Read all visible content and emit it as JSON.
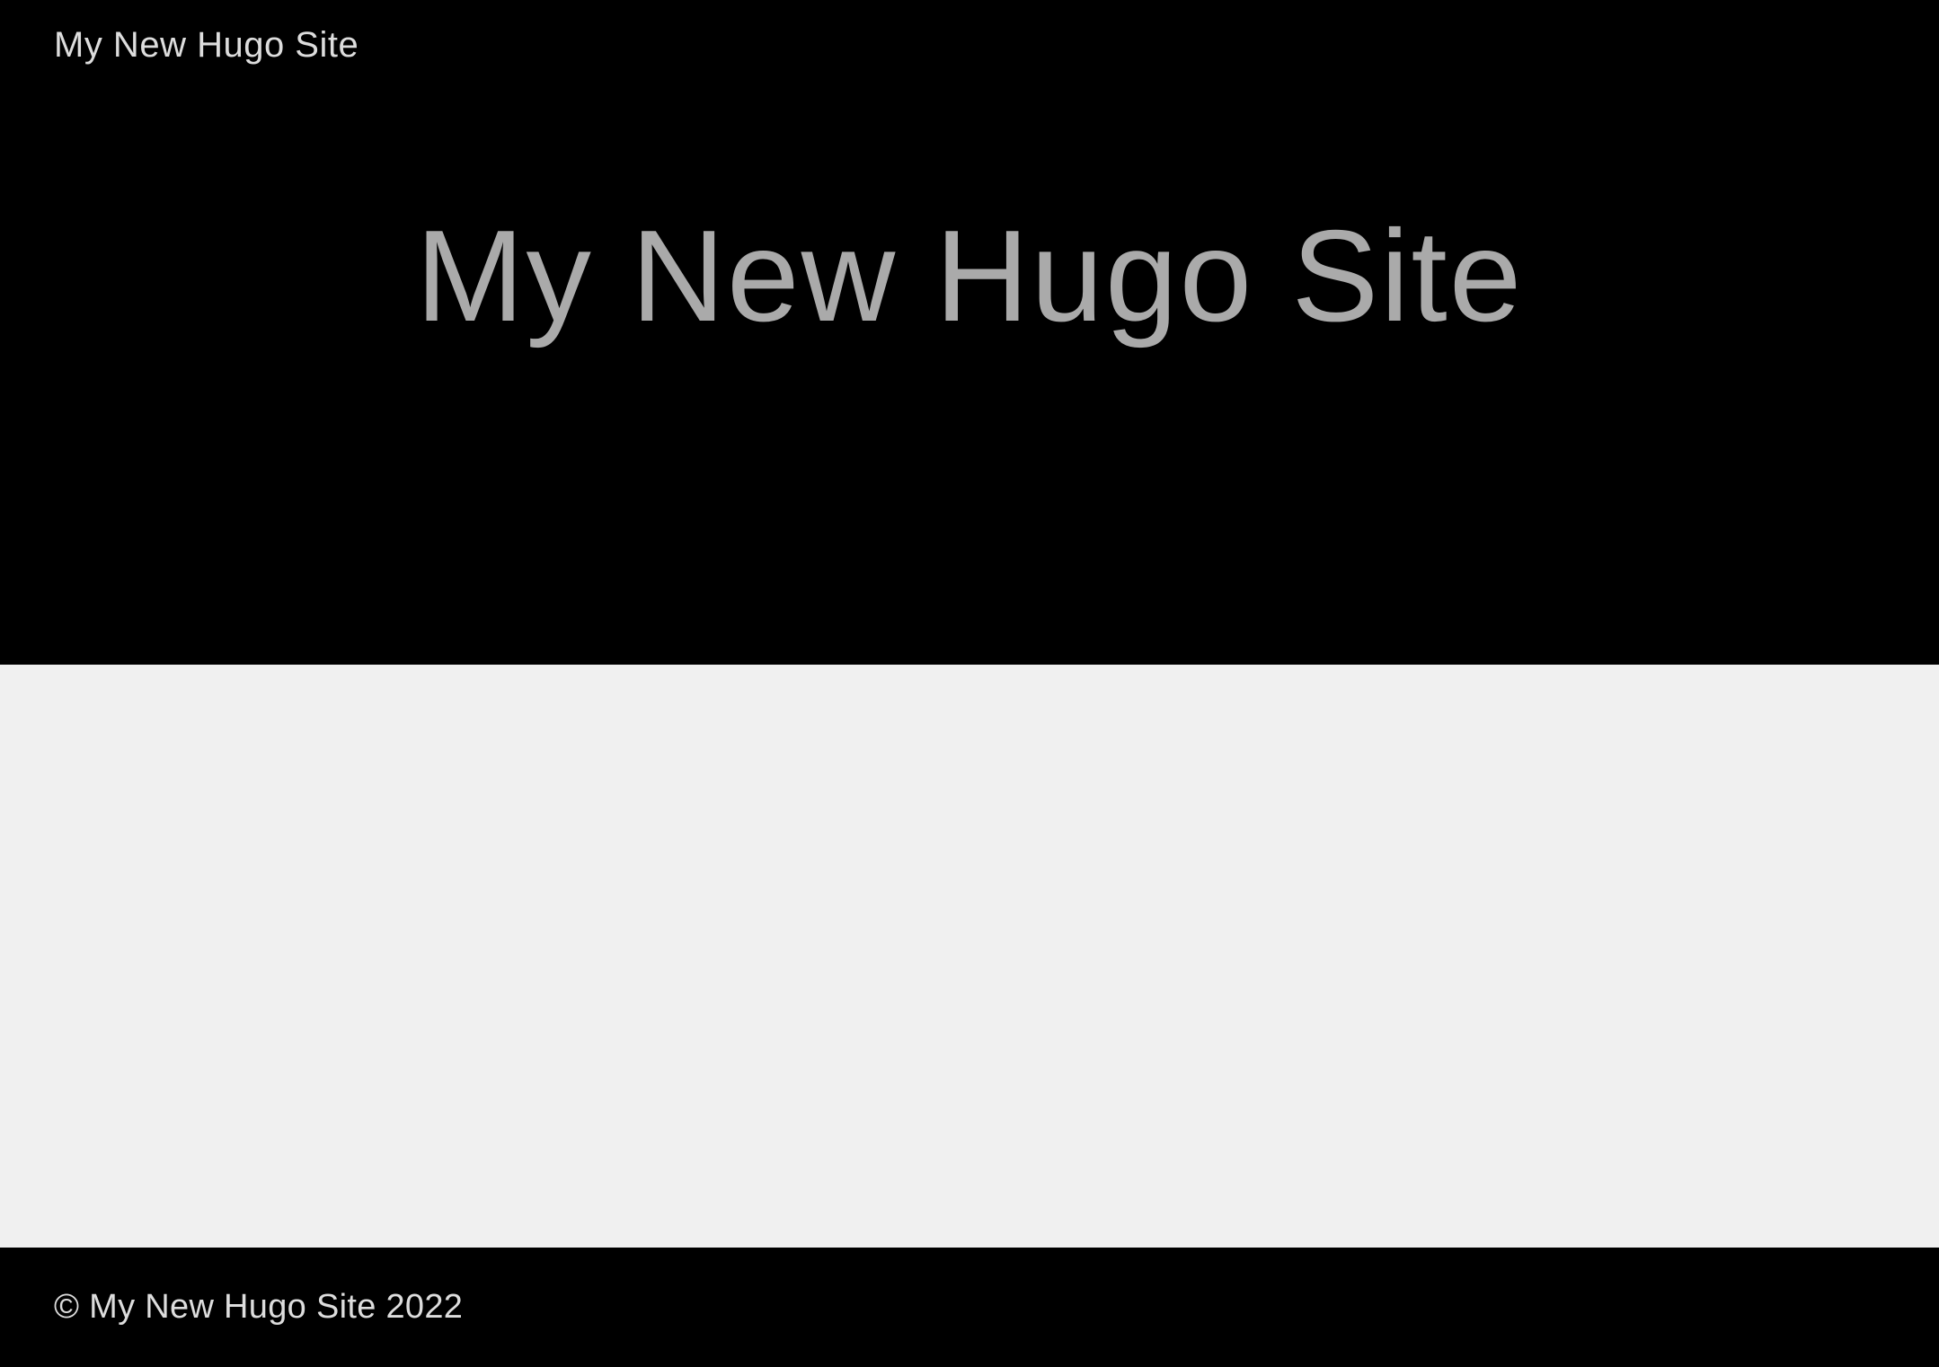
{
  "nav": {
    "site_title": "My New Hugo Site"
  },
  "hero": {
    "title": "My New Hugo Site"
  },
  "footer": {
    "copyright": "© My New Hugo Site 2022"
  }
}
